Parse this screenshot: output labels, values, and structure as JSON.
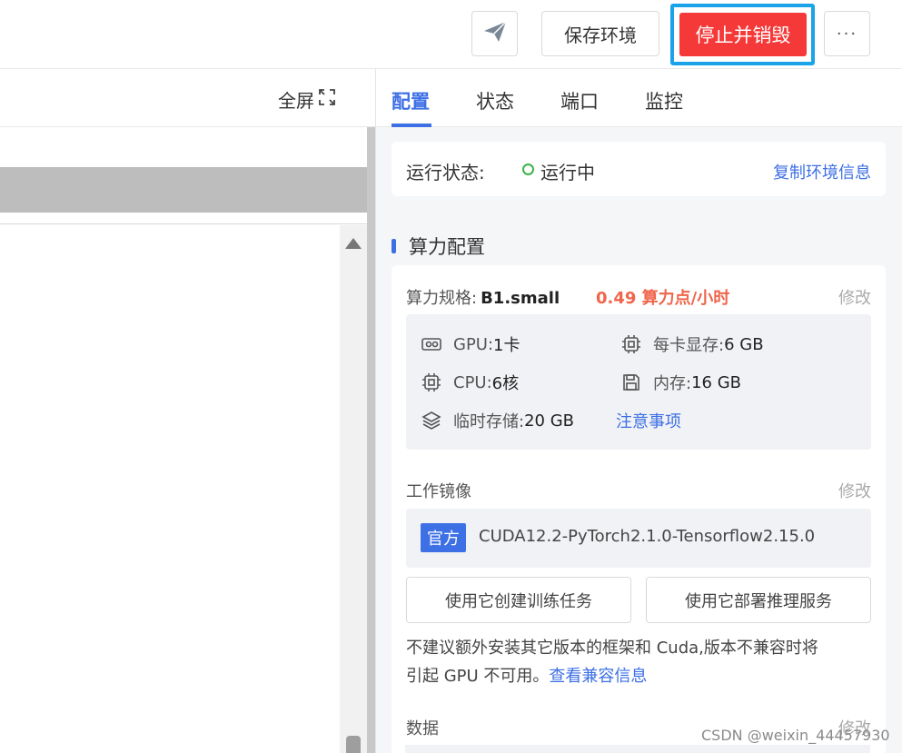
{
  "topbar": {
    "send_icon": "paper-plane-icon",
    "save_env": "保存环境",
    "stop_destroy": "停止并销毁",
    "more": "···",
    "colors": {
      "stop": "#f53838",
      "focus_ring": "#1aa3e8"
    }
  },
  "left": {
    "fullscreen": "全屏",
    "fullscreen_icon": "expand-icon"
  },
  "right": {
    "tabs": [
      "配置",
      "状态",
      "端口",
      "监控"
    ],
    "active_tab": "配置",
    "status": {
      "label": "运行状态:",
      "value": "运行中",
      "copy": "复制环境信息"
    },
    "section_title": "算力配置",
    "spec": {
      "label": "算力规格:",
      "name": "B1.small",
      "price": "0.49 算力点/小时",
      "edit": "修改",
      "gpu_label": "GPU:",
      "gpu_value": "1卡",
      "vram_label": "每卡显存:",
      "vram_value": "6 GB",
      "cpu_label": "CPU:",
      "cpu_value": "6核",
      "mem_label": "内存:",
      "mem_value": "16 GB",
      "tmp_label": "临时存储:",
      "tmp_value": "20 GB",
      "notice": "注意事项"
    },
    "image": {
      "label": "工作镜像",
      "edit": "修改",
      "badge": "官方",
      "name": "CUDA12.2-PyTorch2.1.0-Tensorflow2.15.0",
      "btn_train": "使用它创建训练任务",
      "btn_deploy": "使用它部署推理服务",
      "note_line1": "不建议额外安装其它版本的框架和 Cuda,版本不兼容时将",
      "note_line2": "引起 GPU 不可用。",
      "note_link": "查看兼容信息"
    },
    "data": {
      "label": "数据",
      "edit": "修改"
    }
  },
  "watermark": "CSDN @weixin_44457930"
}
